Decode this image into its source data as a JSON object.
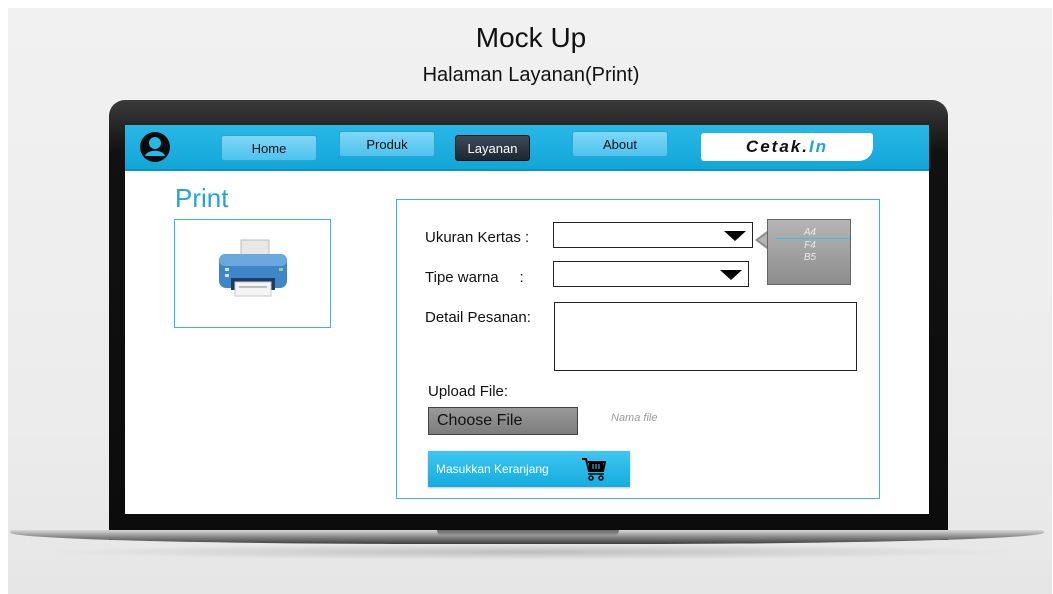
{
  "mockup": {
    "title": "Mock Up",
    "subtitle": "Halaman Layanan(Print)"
  },
  "nav": {
    "items": [
      {
        "label": "Home",
        "active": false
      },
      {
        "label": "Produk",
        "active": false
      },
      {
        "label": "Layanan",
        "active": true
      },
      {
        "label": "About",
        "active": false
      }
    ],
    "brand_main": "Cetak.",
    "brand_accent": "In"
  },
  "page": {
    "heading": "Print"
  },
  "form": {
    "paper_size_label": "Ukuran Kertas :",
    "color_type_label": "Tipe warna     :",
    "detail_label": "Detail Pesanan:",
    "paper_options": [
      "A4",
      "F4",
      "B5"
    ],
    "upload_label": "Upload File:",
    "choose_file": "Choose File",
    "file_name_placeholder": "Nama file",
    "add_to_cart": "Masukkan Keranjang"
  },
  "colors": {
    "accent": "#22a4d8",
    "nav_bar": "#1aaedc",
    "active_tab": "#1d2731"
  }
}
